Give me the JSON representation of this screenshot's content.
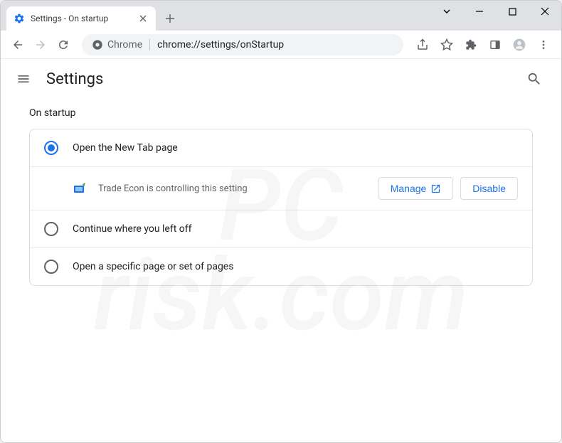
{
  "window": {
    "tab_title": "Settings - On startup",
    "omnibox_prefix": "Chrome",
    "url": "chrome://settings/onStartup"
  },
  "header": {
    "title": "Settings"
  },
  "section": {
    "title": "On startup"
  },
  "options": {
    "open_new_tab": "Open the New Tab page",
    "continue": "Continue where you left off",
    "specific": "Open a specific page or set of pages"
  },
  "extension_notice": {
    "text": "Trade Econ is controlling this setting",
    "manage_label": "Manage",
    "disable_label": "Disable"
  },
  "watermark": {
    "line1": "PC",
    "line2": "risk.com"
  }
}
